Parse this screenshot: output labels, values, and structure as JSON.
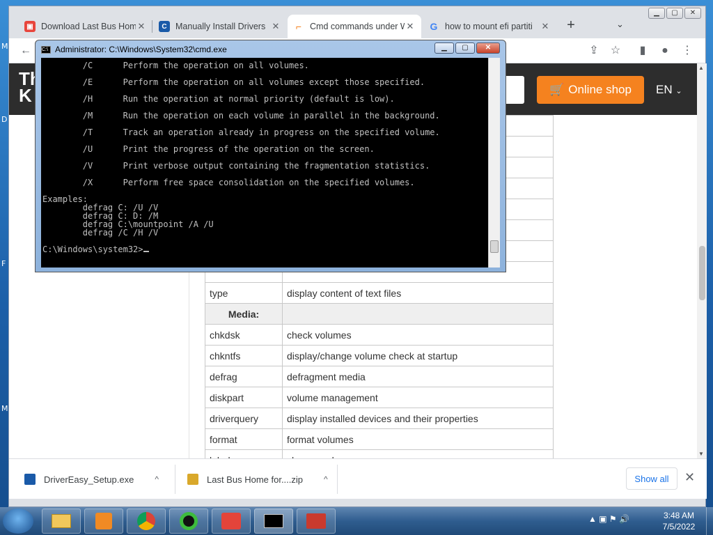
{
  "browser": {
    "tabs": [
      {
        "title": "Download Last Bus Hom",
        "icon_color": "#e8453c",
        "close": "✕"
      },
      {
        "title": "Manually Install Drivers",
        "icon_color": "#1a5aa8",
        "close": "✕"
      },
      {
        "title": "Cmd commands under W",
        "icon_color": "#f5821f",
        "close": "✕"
      },
      {
        "title": "how to mount efi partiti",
        "icon_color": "#4285f4",
        "close": "✕"
      }
    ],
    "new_tab": "+",
    "tab_search": "⌄"
  },
  "site": {
    "logo": "Th\nK",
    "shop_button": "Online shop",
    "language": "EN"
  },
  "table": {
    "rows": [
      {
        "cmd": "",
        "desc": "",
        "section": false
      },
      {
        "cmd": "",
        "desc": "",
        "section": false
      },
      {
        "cmd": "",
        "desc": "",
        "section": false
      },
      {
        "cmd": "",
        "desc": "",
        "section": false
      },
      {
        "cmd": "",
        "desc": "",
        "section": false
      },
      {
        "cmd": "",
        "desc": "",
        "section": false
      },
      {
        "cmd": "",
        "desc": "",
        "section": false
      },
      {
        "cmd": "",
        "desc": "",
        "section": false
      },
      {
        "cmd": "type",
        "desc": "display content of text files",
        "section": false
      },
      {
        "cmd": "Media:",
        "desc": "",
        "section": true
      },
      {
        "cmd": "chkdsk",
        "desc": "check volumes",
        "section": false
      },
      {
        "cmd": "chkntfs",
        "desc": "display/change volume check at startup",
        "section": false
      },
      {
        "cmd": "defrag",
        "desc": "defragment media",
        "section": false
      },
      {
        "cmd": "diskpart",
        "desc": "volume management",
        "section": false
      },
      {
        "cmd": "driverquery",
        "desc": "display installed devices and their properties",
        "section": false
      },
      {
        "cmd": "format",
        "desc": "format volumes",
        "section": false
      },
      {
        "cmd": "label",
        "desc": "change volume name",
        "section": false
      }
    ]
  },
  "downloads": {
    "items": [
      {
        "name": "DriverEasy_Setup.exe",
        "chevron": "^"
      },
      {
        "name": "Last Bus Home for....zip",
        "chevron": "^"
      }
    ],
    "show_all": "Show all",
    "close": "✕"
  },
  "cmd": {
    "title": "Administrator: C:\\Windows\\System32\\cmd.exe",
    "lines": [
      "        /C      Perform the operation on all volumes.",
      "",
      "        /E      Perform the operation on all volumes except those specified.",
      "",
      "        /H      Run the operation at normal priority (default is low).",
      "",
      "        /M      Run the operation on each volume in parallel in the background.",
      "",
      "        /T      Track an operation already in progress on the specified volume.",
      "",
      "        /U      Print the progress of the operation on the screen.",
      "",
      "        /V      Print verbose output containing the fragmentation statistics.",
      "",
      "        /X      Perform free space consolidation on the specified volumes.",
      "",
      "Examples:",
      "",
      "        defrag C: /U /V",
      "        defrag C: D: /M",
      "        defrag C:\\mountpoint /A /U",
      "        defrag /C /H /V",
      "",
      "C:\\Windows\\system32>"
    ]
  },
  "taskbar": {
    "apps": [
      "file-explorer",
      "media-player",
      "chrome",
      "app-green",
      "app-game",
      "cmd",
      "toolbox"
    ],
    "time": "3:48 AM",
    "date": "7/5/2022"
  },
  "desktop_edge": [
    "M",
    "D",
    "F",
    "M"
  ]
}
